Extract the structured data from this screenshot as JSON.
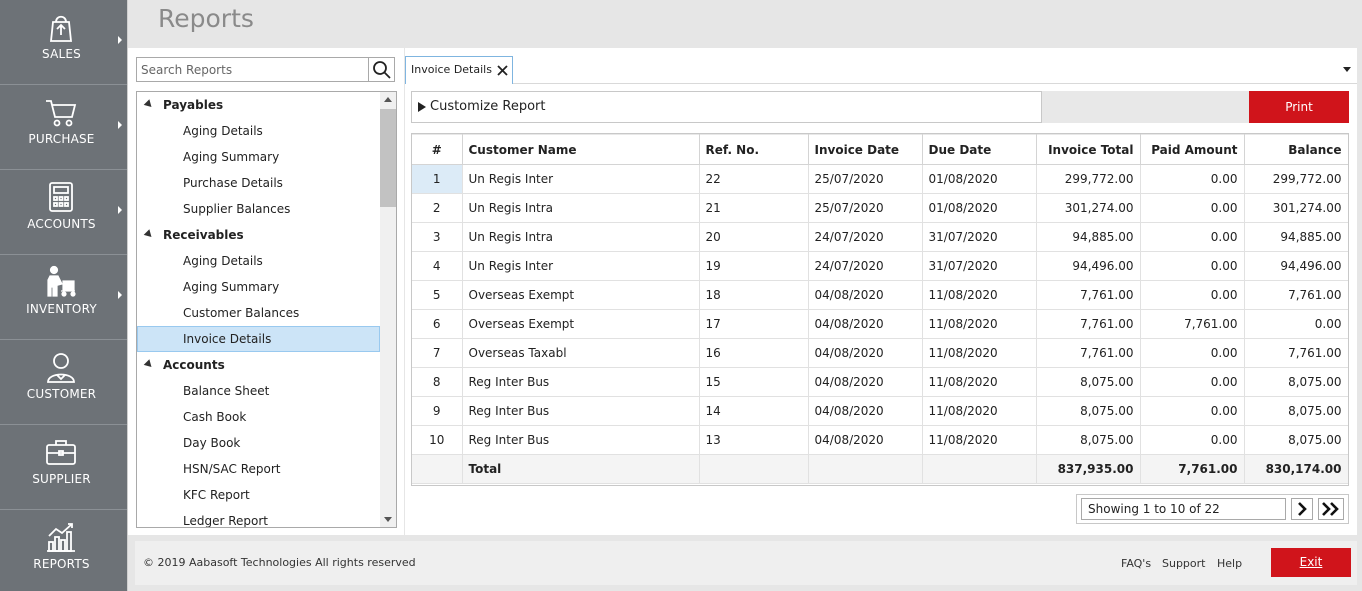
{
  "nav": {
    "items": [
      {
        "label": "SALES",
        "icon": "shopping-bag-icon",
        "has_submenu": true
      },
      {
        "label": "PURCHASE",
        "icon": "cart-icon",
        "has_submenu": true
      },
      {
        "label": "ACCOUNTS",
        "icon": "calculator-icon",
        "has_submenu": true
      },
      {
        "label": "INVENTORY",
        "icon": "inventory-worker-icon",
        "has_submenu": true
      },
      {
        "label": "CUSTOMER",
        "icon": "person-icon",
        "has_submenu": false
      },
      {
        "label": "SUPPLIER",
        "icon": "briefcase-icon",
        "has_submenu": false
      },
      {
        "label": "REPORTS",
        "icon": "bar-chart-icon",
        "has_submenu": false
      }
    ]
  },
  "header": {
    "title": "Reports"
  },
  "search": {
    "placeholder": "Search Reports",
    "value": ""
  },
  "tree": {
    "rows": [
      {
        "type": "group",
        "label": "Payables"
      },
      {
        "type": "leaf",
        "label": "Aging Details"
      },
      {
        "type": "leaf",
        "label": "Aging Summary"
      },
      {
        "type": "leaf",
        "label": "Purchase Details"
      },
      {
        "type": "leaf",
        "label": "Supplier Balances"
      },
      {
        "type": "group",
        "label": "Receivables"
      },
      {
        "type": "leaf",
        "label": "Aging Details"
      },
      {
        "type": "leaf",
        "label": "Aging Summary"
      },
      {
        "type": "leaf",
        "label": "Customer Balances"
      },
      {
        "type": "leaf",
        "label": "Invoice Details",
        "selected": true
      },
      {
        "type": "group",
        "label": "Accounts"
      },
      {
        "type": "leaf",
        "label": "Balance Sheet"
      },
      {
        "type": "leaf",
        "label": "Cash Book"
      },
      {
        "type": "leaf",
        "label": "Day Book"
      },
      {
        "type": "leaf",
        "label": "HSN/SAC Report"
      },
      {
        "type": "leaf",
        "label": "KFC Report"
      },
      {
        "type": "leaf",
        "label": "Ledger Report"
      }
    ]
  },
  "tabs": [
    {
      "label": "Invoice Details",
      "active": true
    }
  ],
  "customize": {
    "label": "Customize Report"
  },
  "print_label": "Print",
  "table": {
    "columns": [
      "#",
      "Customer Name",
      "Ref. No.",
      "Invoice Date",
      "Due Date",
      "Invoice Total",
      "Paid Amount",
      "Balance"
    ],
    "rows": [
      [
        "1",
        "Un Regis Inter",
        "22",
        "25/07/2020",
        "01/08/2020",
        "299,772.00",
        "0.00",
        "299,772.00"
      ],
      [
        "2",
        "Un Regis Intra",
        "21",
        "25/07/2020",
        "01/08/2020",
        "301,274.00",
        "0.00",
        "301,274.00"
      ],
      [
        "3",
        "Un Regis Intra",
        "20",
        "24/07/2020",
        "31/07/2020",
        "94,885.00",
        "0.00",
        "94,885.00"
      ],
      [
        "4",
        "Un Regis Inter",
        "19",
        "24/07/2020",
        "31/07/2020",
        "94,496.00",
        "0.00",
        "94,496.00"
      ],
      [
        "5",
        "Overseas Exempt",
        "18",
        "04/08/2020",
        "11/08/2020",
        "7,761.00",
        "0.00",
        "7,761.00"
      ],
      [
        "6",
        "Overseas Exempt",
        "17",
        "04/08/2020",
        "11/08/2020",
        "7,761.00",
        "7,761.00",
        "0.00"
      ],
      [
        "7",
        "Overseas Taxabl",
        "16",
        "04/08/2020",
        "11/08/2020",
        "7,761.00",
        "0.00",
        "7,761.00"
      ],
      [
        "8",
        "Reg Inter Bus",
        "15",
        "04/08/2020",
        "11/08/2020",
        "8,075.00",
        "0.00",
        "8,075.00"
      ],
      [
        "9",
        "Reg Inter Bus",
        "14",
        "04/08/2020",
        "11/08/2020",
        "8,075.00",
        "0.00",
        "8,075.00"
      ],
      [
        "10",
        "Reg Inter Bus",
        "13",
        "04/08/2020",
        "11/08/2020",
        "8,075.00",
        "0.00",
        "8,075.00"
      ]
    ],
    "total": {
      "label": "Total",
      "invoice_total": "837,935.00",
      "paid_amount": "7,761.00",
      "balance": "830,174.00"
    }
  },
  "pager": {
    "text": "Showing 1 to 10 of 22"
  },
  "footer": {
    "copyright": "© 2019 Aabasoft Technologies All rights reserved",
    "faq": "FAQ's",
    "support": "Support",
    "help": "Help",
    "exit": "Exit"
  },
  "colors": {
    "nav_bg": "#6d7277",
    "accent_red": "#d0141b",
    "selected_bg": "#cce4f7"
  }
}
